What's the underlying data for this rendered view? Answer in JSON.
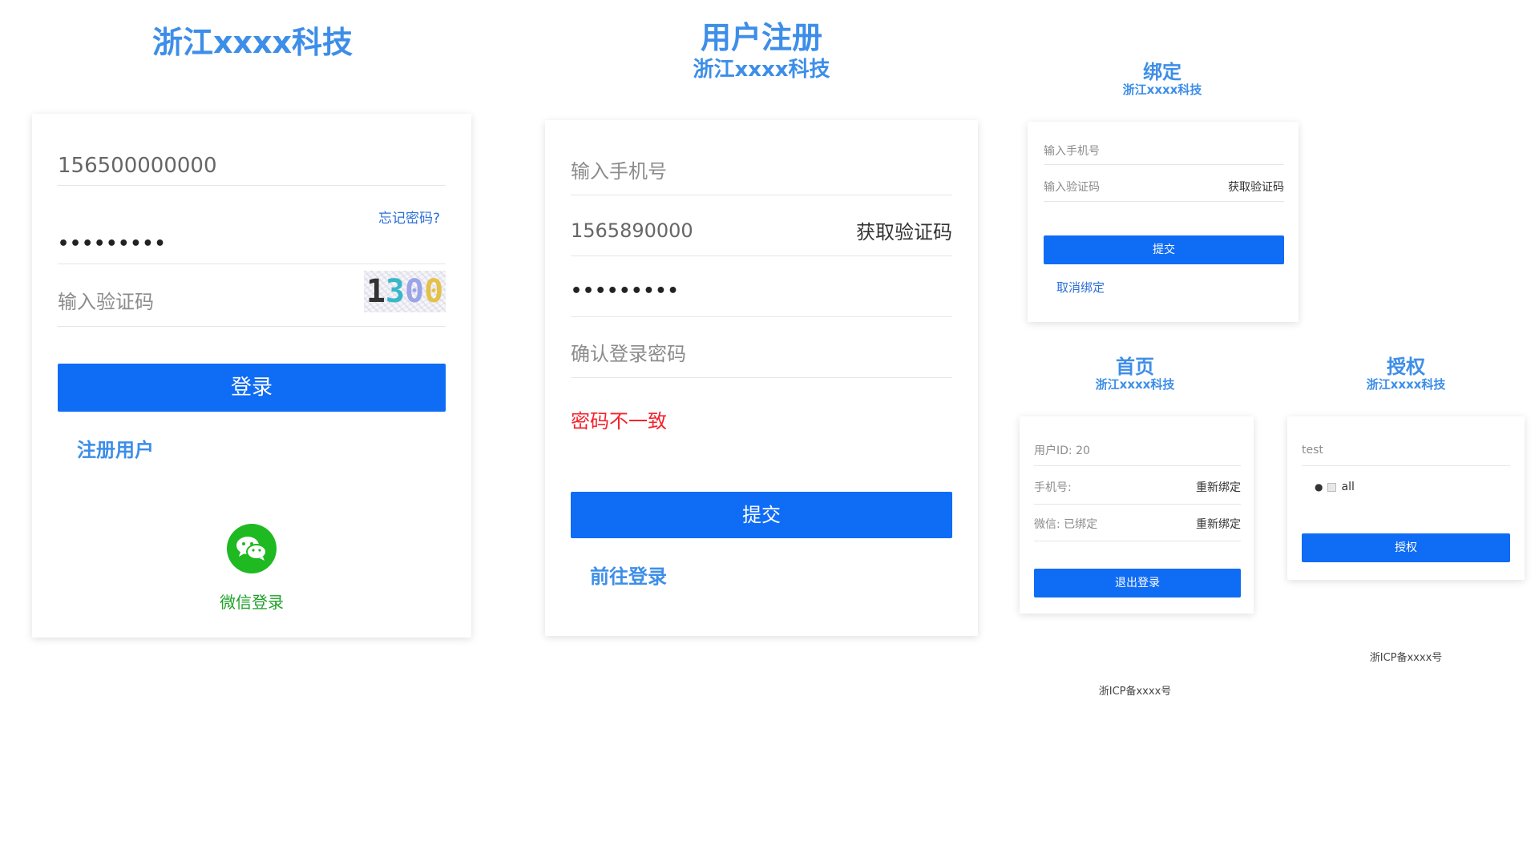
{
  "login": {
    "title": "浙江xxxx科技",
    "phone_value": "156500000000",
    "password_mask": "•••••••••",
    "forgot_label": "忘记密码?",
    "captcha_placeholder": "输入验证码",
    "captcha_text": [
      "1",
      "3",
      "0",
      "0"
    ],
    "login_button": "登录",
    "register_link": "注册用户",
    "wechat_label": "微信登录"
  },
  "register": {
    "title": "用户注册",
    "subtitle": "浙江xxxx科技",
    "phone_placeholder": "输入手机号",
    "code_value": "1565890000",
    "get_code_label": "获取验证码",
    "password_mask": "•••••••••",
    "confirm_placeholder": "确认登录密码",
    "error_text": "密码不一致",
    "submit_button": "提交",
    "goto_login": "前往登录"
  },
  "bind": {
    "title": "绑定",
    "subtitle": "浙江xxxx科技",
    "phone_placeholder": "输入手机号",
    "code_placeholder": "输入验证码",
    "get_code_label": "获取验证码",
    "submit_button": "提交",
    "cancel_link": "取消绑定"
  },
  "home": {
    "title": "首页",
    "subtitle": "浙江xxxx科技",
    "user_id": "用户ID: 20",
    "phone_label": "手机号:",
    "rebind_phone": "重新绑定",
    "wechat_label": "微信: 已绑定",
    "rebind_wechat": "重新绑定",
    "logout_button": "退出登录",
    "icp": "浙ICP备xxxx号"
  },
  "auth": {
    "title": "授权",
    "subtitle": "浙江xxxx科技",
    "app_name": "test",
    "scope_label": "all",
    "authorize_button": "授权",
    "icp": "浙ICP备xxxx号"
  },
  "colors": {
    "brand_blue": "#3d8ee8",
    "button_blue": "#0f6cf5",
    "error_red": "#f5222d",
    "wechat_green": "#1fb922"
  }
}
